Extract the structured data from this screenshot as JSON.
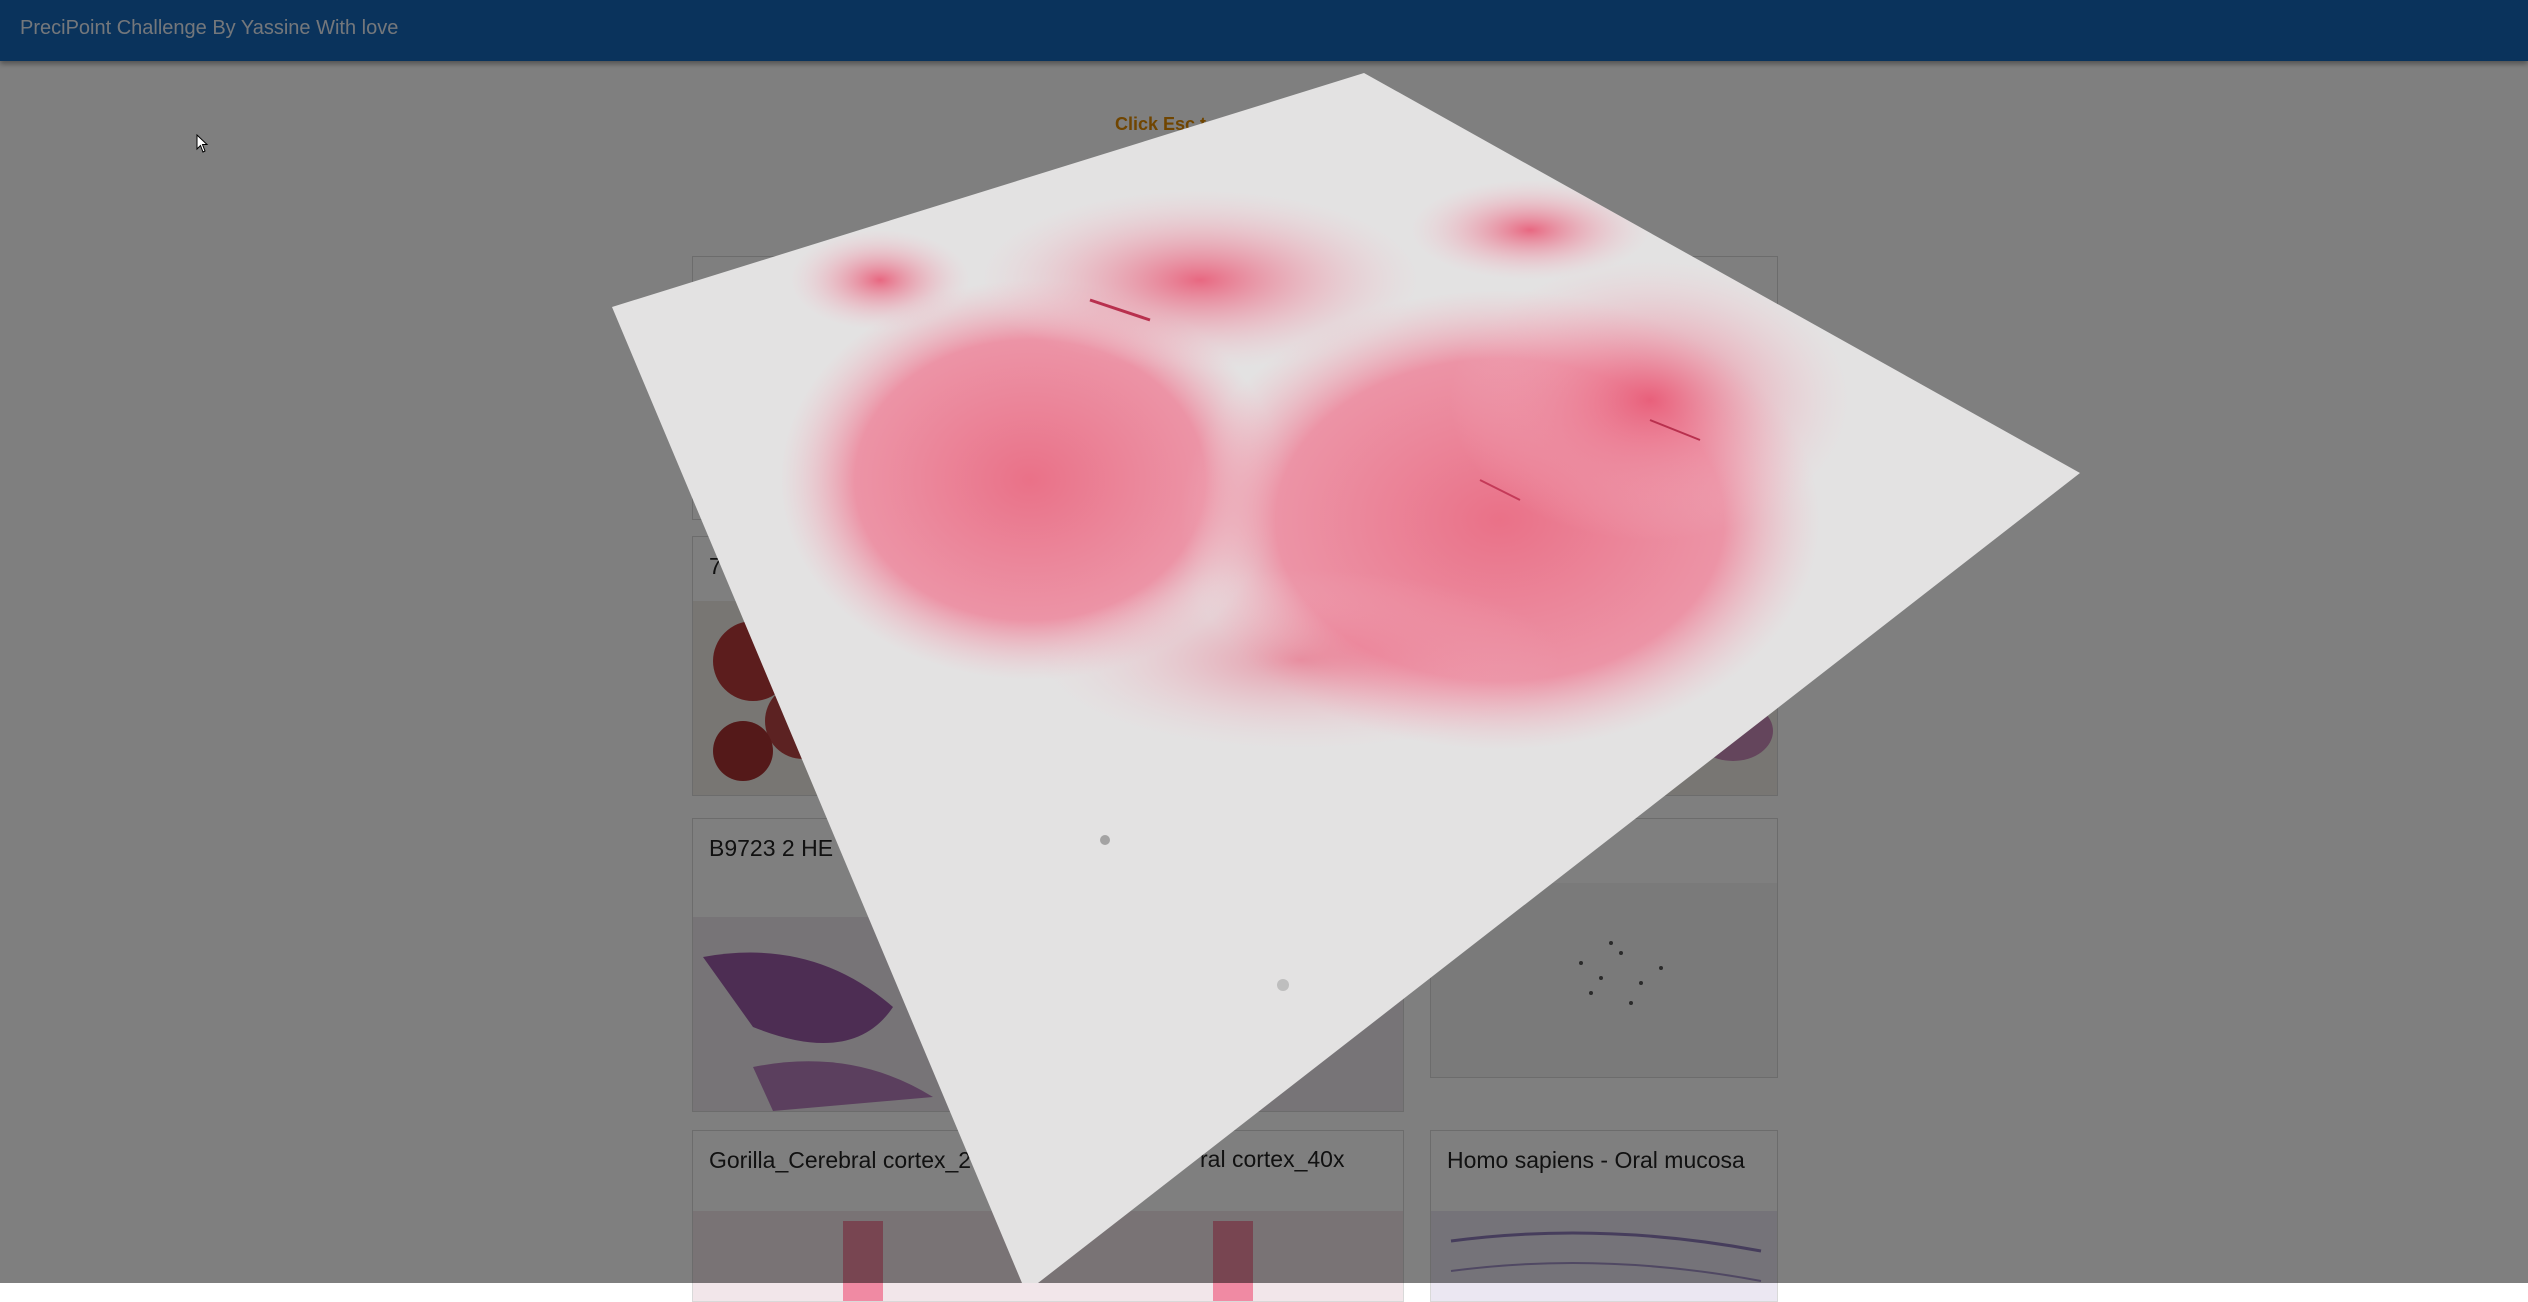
{
  "app": {
    "title": "PreciPoint Challenge By Yassine With love"
  },
  "hint": "Click Esc t",
  "cards": [
    {
      "title": "",
      "thumb": "tissue-pink"
    },
    {
      "title": "7",
      "thumb": "tissue-red-dots"
    },
    {
      "title": "B9723 2 HE",
      "thumb": "tissue-purple"
    },
    {
      "title": "",
      "thumb": "tissue-sparse"
    },
    {
      "title": "Gorilla_Cerebral cortex_2",
      "thumb": "tissue-cortex"
    },
    {
      "title": "ral cortex_40x",
      "thumb": "tissue-cortex"
    },
    {
      "title": "Homo sapiens - Oral mucosa",
      "thumb": "tissue-mucosa"
    }
  ],
  "modal": {
    "image": "histology-slide-pink-tissue",
    "state": "3d-tilted-preview"
  },
  "colors": {
    "topbar": "#1466b8",
    "hint": "#e08a00",
    "tissue": "#e8667e"
  }
}
